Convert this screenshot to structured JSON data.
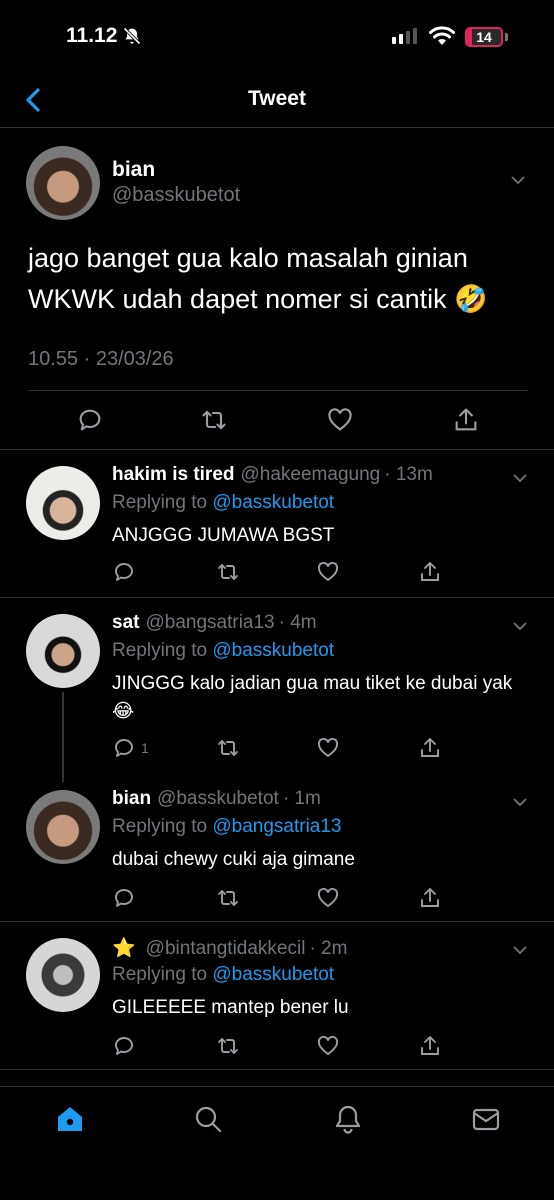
{
  "status_bar": {
    "time": "11.12",
    "battery_level": "14",
    "battery_fraction": 0.14,
    "icons": [
      "bell-slash-icon",
      "cellular-signal-icon",
      "wifi-icon",
      "battery-icon"
    ]
  },
  "header": {
    "title": "Tweet",
    "back_icon": "chevron-left-icon"
  },
  "main_tweet": {
    "name": "bian",
    "handle": "@basskubetot",
    "text": "jago banget gua kalo masalah ginian WKWK udah dapet nomer si cantik 🤣",
    "timestamp": "10.55 · 23/03/26",
    "actions": [
      "reply-icon",
      "retweet-icon",
      "like-icon",
      "share-icon"
    ]
  },
  "replies": [
    {
      "name": "hakim is tired",
      "handle": "@hakeemagung",
      "time": "· 13m",
      "replying_prefix": "Replying to",
      "replying_to": "@basskubetot",
      "text": "ANJGGG JUMAWA BGST",
      "reply_count": ""
    },
    {
      "name": "sat",
      "handle": "@bangsatria13",
      "time": "· 4m",
      "replying_prefix": "Replying to",
      "replying_to": "@basskubetot",
      "text": "JINGGG kalo jadian gua mau tiket ke dubai yak 😂",
      "reply_count": "1"
    },
    {
      "name": "bian",
      "handle": "@basskubetot",
      "time": "· 1m",
      "replying_prefix": "Replying to",
      "replying_to": "@bangsatria13",
      "text": "dubai chewy cuki aja gimane",
      "reply_count": ""
    },
    {
      "name": "⭐",
      "handle": "@bintangtidakkecil",
      "time": "· 2m",
      "replying_prefix": "Replying to",
      "replying_to": "@basskubetot",
      "text": "GILEEEEE mantep bener lu",
      "reply_count": ""
    }
  ],
  "tab_bar": {
    "tabs": [
      "home-icon",
      "search-icon",
      "notifications-icon",
      "messages-icon"
    ],
    "active_color": "#1d9bf0"
  },
  "colors": {
    "accent": "#1d9bf0",
    "muted": "#71767b",
    "divider": "#2f3336",
    "battery_low": "#e0245e"
  }
}
